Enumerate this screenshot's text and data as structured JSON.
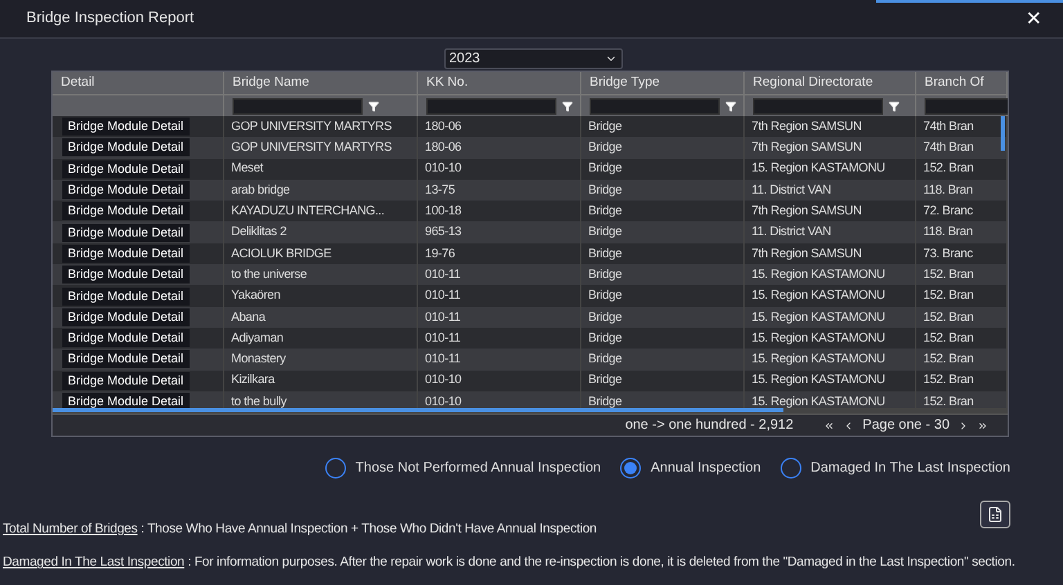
{
  "window": {
    "title": "Bridge Inspection Report",
    "close": "✕"
  },
  "year_select": {
    "value": "2023"
  },
  "table": {
    "columns": [
      {
        "label": "Detail",
        "filterable": false
      },
      {
        "label": "Bridge Name",
        "filterable": true
      },
      {
        "label": "KK No.",
        "filterable": true
      },
      {
        "label": "Bridge Type",
        "filterable": true
      },
      {
        "label": "Regional Directorate",
        "filterable": true
      },
      {
        "label": "Branch Of",
        "filterable": true
      }
    ],
    "rows": [
      {
        "cells": [
          "Bridge Module Detail",
          "GOP UNIVERSITY MARTYRS",
          "180-06",
          "Bridge",
          "7th Region SAMSUN",
          "74th Bran"
        ]
      },
      {
        "cells": [
          "Bridge Module Detail",
          "GOP UNIVERSITY MARTYRS",
          "180-06",
          "Bridge",
          "7th Region SAMSUN",
          "74th Bran"
        ]
      },
      {
        "cells": [
          "Bridge Module Detail",
          "Meset",
          "010-10",
          "Bridge",
          "15. Region KASTAMONU",
          "152. Bran"
        ]
      },
      {
        "cells": [
          "Bridge Module Detail",
          "arab bridge",
          "13-75",
          "Bridge",
          "11. District VAN",
          "118. Bran"
        ]
      },
      {
        "cells": [
          "Bridge Module Detail",
          "KAYADUZU INTERCHANG...",
          "100-18",
          "Bridge",
          "7th Region SAMSUN",
          "72. Branc"
        ]
      },
      {
        "cells": [
          "Bridge Module Detail",
          "Deliklitas 2",
          "965-13",
          "Bridge",
          "11. District VAN",
          "118. Bran"
        ]
      },
      {
        "cells": [
          "Bridge Module Detail",
          "ACIOLUK BRIDGE",
          "19-76",
          "Bridge",
          "7th Region SAMSUN",
          "73. Branc"
        ]
      },
      {
        "cells": [
          "Bridge Module Detail",
          "to the universe",
          "010-11",
          "Bridge",
          "15. Region KASTAMONU",
          "152. Bran"
        ]
      },
      {
        "cells": [
          "Bridge Module Detail",
          "Yakaören",
          "010-11",
          "Bridge",
          "15. Region KASTAMONU",
          "152. Bran"
        ]
      },
      {
        "cells": [
          "Bridge Module Detail",
          "Abana",
          "010-11",
          "Bridge",
          "15. Region KASTAMONU",
          "152. Bran"
        ]
      },
      {
        "cells": [
          "Bridge Module Detail",
          "Adiyaman",
          "010-11",
          "Bridge",
          "15. Region KASTAMONU",
          "152. Bran"
        ]
      },
      {
        "cells": [
          "Bridge Module Detail",
          "Monastery",
          "010-11",
          "Bridge",
          "15. Region KASTAMONU",
          "152. Bran"
        ]
      },
      {
        "cells": [
          "Bridge Module Detail",
          "Kizilkara",
          "010-10",
          "Bridge",
          "15. Region KASTAMONU",
          "152. Bran"
        ]
      },
      {
        "cells": [
          "Bridge Module Detail",
          "to the bully",
          "010-10",
          "Bridge",
          "15. Region KASTAMONU",
          "152. Bran"
        ]
      }
    ],
    "pager": {
      "summary": "one -> one hundred - 2,912",
      "page": "Page one - 30"
    }
  },
  "radio_options": [
    {
      "label": "Those Not Performed Annual Inspection",
      "selected": false
    },
    {
      "label": "Annual Inspection",
      "selected": true
    },
    {
      "label": "Damaged In The Last Inspection",
      "selected": false
    }
  ],
  "notes": [
    {
      "term": "Total Number of Bridges",
      "text": " : Those Who Have Annual Inspection + Those Who Didn't Have Annual Inspection"
    },
    {
      "term": "Damaged In The Last Inspection",
      "text": " : For information purposes. After the repair work is done and the re-inspection is done, it is deleted from the \"Damaged in the Last Inspection\" section."
    }
  ]
}
